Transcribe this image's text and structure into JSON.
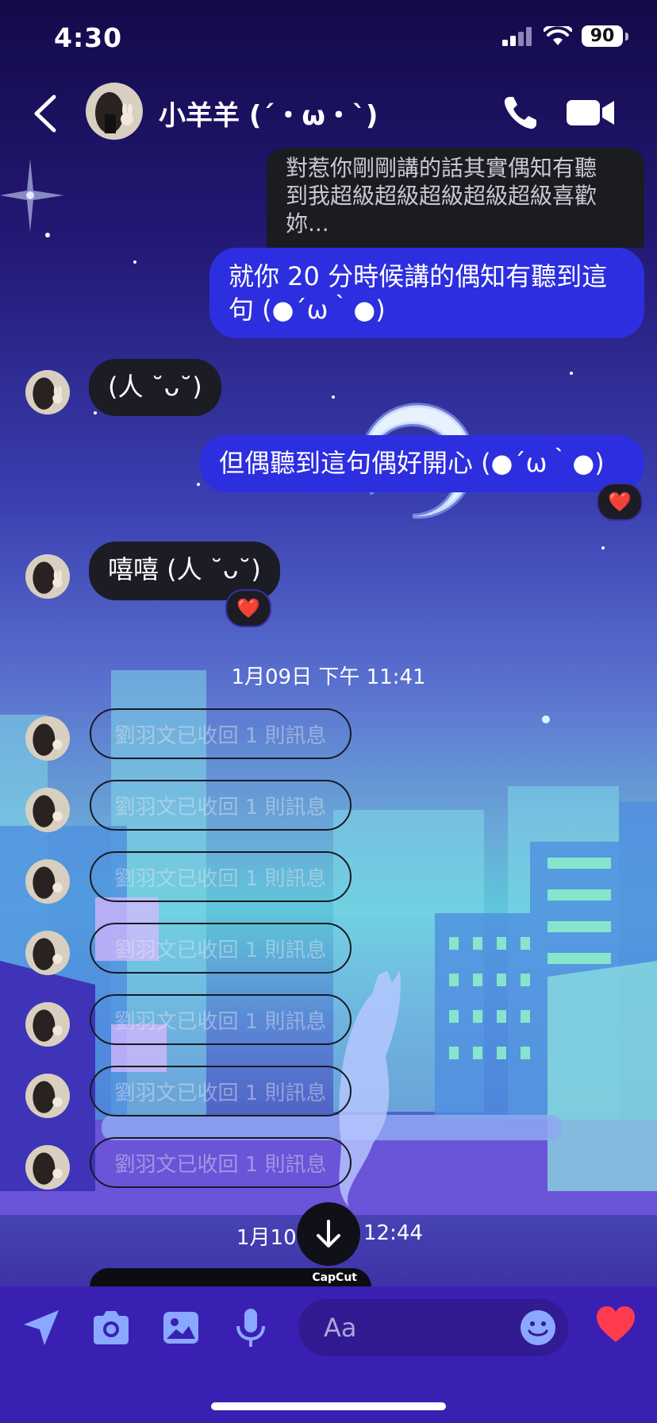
{
  "status_bar": {
    "time": "4:30",
    "battery": "90"
  },
  "header": {
    "contact_name": "小羊羊 (´・ω・`)"
  },
  "messages": {
    "reply_preview": [
      "對惹你剛剛講的話其實偶知有聽",
      "到我超級超級超級超級超級喜歡",
      "妳..."
    ],
    "out_1": [
      "就你 20 分時候講的偶知有聽到這",
      "句 (●´ω｀●)"
    ],
    "in_1": "(人 ˘ᴗ˘)",
    "out_2": "但偶聽到這句偶好開心 (●´ω｀●)",
    "in_2": "嘻嘻 (人 ˘ᴗ˘)",
    "reaction": "❤️"
  },
  "timestamps": {
    "first": "1月09日 下午 11:41",
    "second_left": "1月10",
    "second_right": "12:44"
  },
  "recalled_messages": [
    "劉羽文已收回 1 則訊息",
    "劉羽文已收回 1 則訊息",
    "劉羽文已收回 1 則訊息",
    "劉羽文已收回 1 則訊息",
    "劉羽文已收回 1 則訊息",
    "劉羽文已收回 1 則訊息",
    "劉羽文已收回 1 則訊息"
  ],
  "capcut_label": "CapCut",
  "composer": {
    "placeholder": "Aa"
  },
  "colors": {
    "outgoing_bubble": "#2d2ee0",
    "composer_bg": "#3a1fb3",
    "heart": "#ff3b4f"
  }
}
